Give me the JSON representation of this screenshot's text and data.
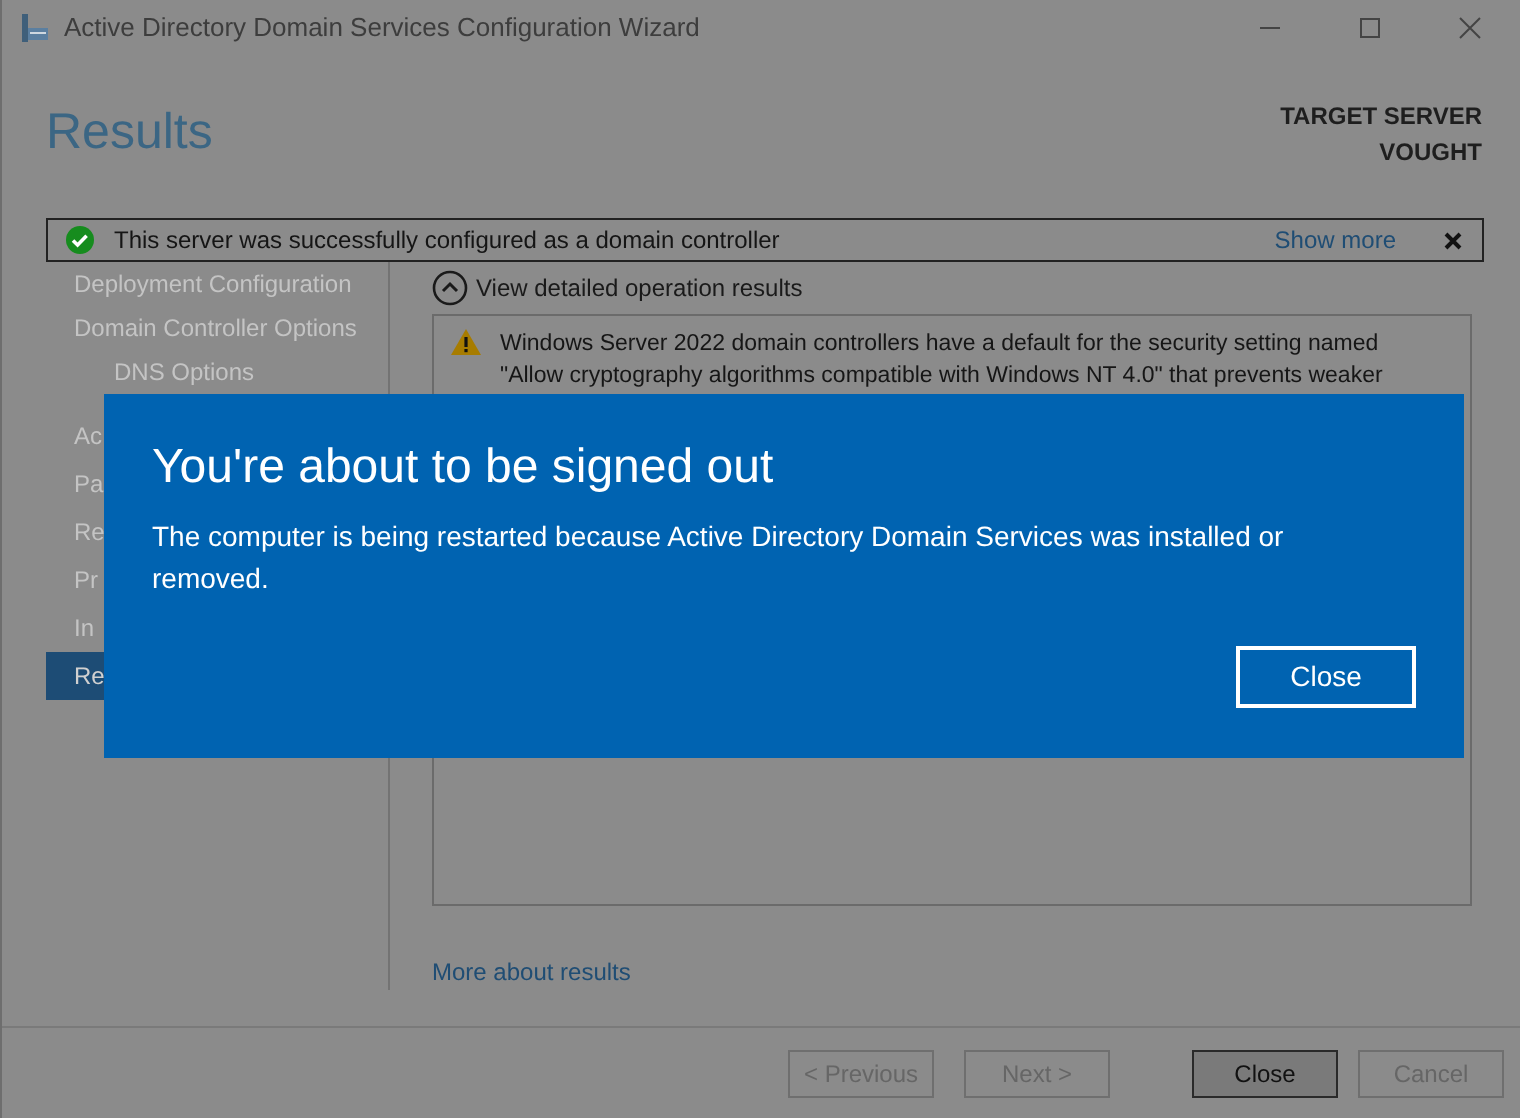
{
  "window": {
    "title": "Active Directory Domain Services Configuration Wizard"
  },
  "header": {
    "title": "Results",
    "target_label": "TARGET SERVER",
    "server": "VOUGHT"
  },
  "banner": {
    "message": "This server was successfully configured as a domain controller",
    "link": "Show more"
  },
  "sidebar": {
    "items": [
      {
        "label": "Deployment Configuration",
        "selected": false
      },
      {
        "label": "Domain Controller Options",
        "selected": false,
        "children": [
          {
            "label": "DNS Options",
            "selected": false
          }
        ]
      },
      {
        "label": "Ac",
        "selected": false
      },
      {
        "label": "Pa",
        "selected": false
      },
      {
        "label": "Re",
        "selected": false
      },
      {
        "label": "Pr",
        "selected": false
      },
      {
        "label": "In",
        "selected": false
      },
      {
        "label": "Re",
        "selected": true
      }
    ]
  },
  "details": {
    "toggle": "View detailed operation results",
    "expanded": true,
    "warning_lines": [
      "Windows Server 2022 domain controllers have a default for the security setting named",
      "\"Allow cryptography algorithms compatible with Windows NT 4.0\" that prevents weaker"
    ]
  },
  "more_link": "More about results",
  "buttons": [
    {
      "label": "< Previous",
      "disabled": true,
      "default": false
    },
    {
      "label": "Next >",
      "disabled": true,
      "default": false
    },
    {
      "label": "Close",
      "disabled": false,
      "default": true
    },
    {
      "label": "Cancel",
      "disabled": true,
      "default": false
    }
  ],
  "dialog": {
    "title": "You're about to be signed out",
    "message": "The computer is being restarted because Active Directory Domain Services was installed or removed.",
    "button": "Close"
  }
}
